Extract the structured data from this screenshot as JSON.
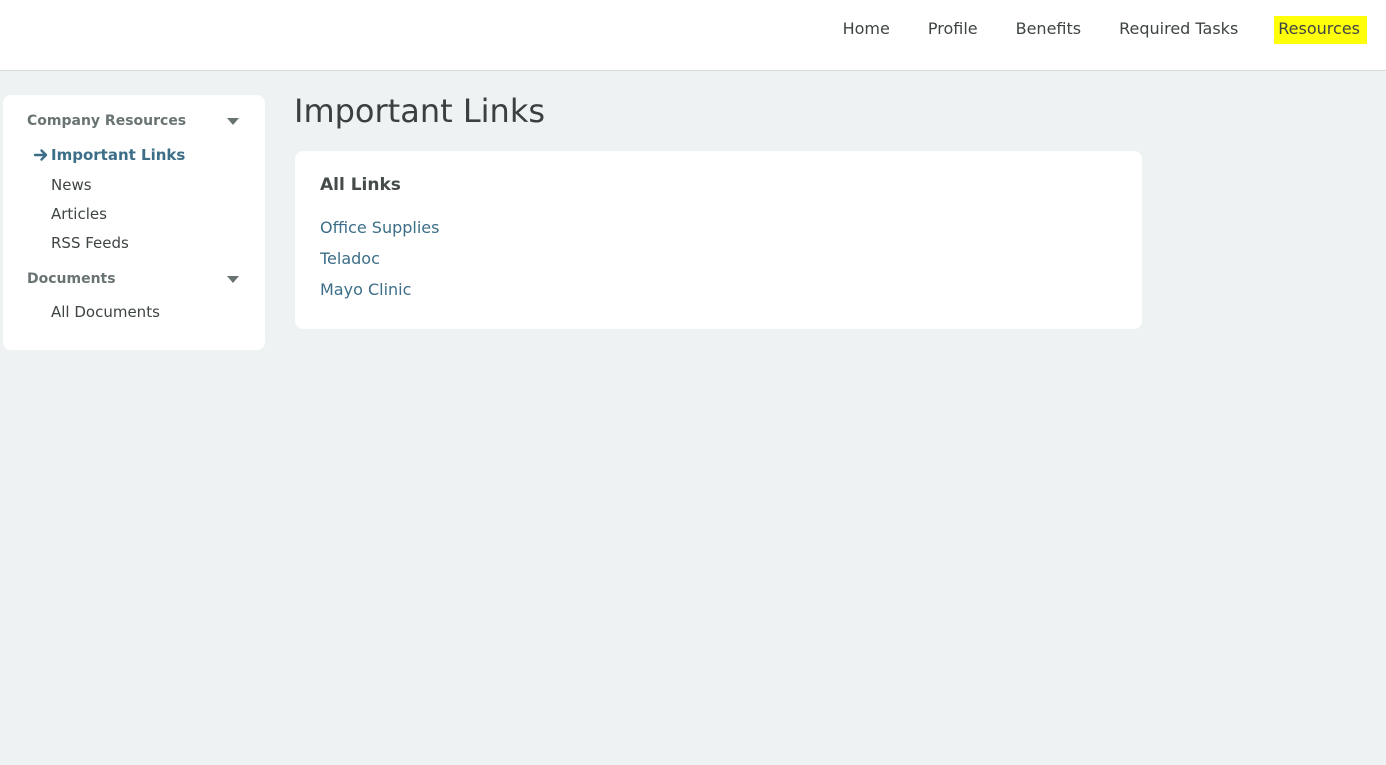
{
  "topnav": {
    "items": [
      {
        "label": "Home"
      },
      {
        "label": "Profile"
      },
      {
        "label": "Benefits"
      },
      {
        "label": "Required Tasks"
      },
      {
        "label": "Resources",
        "active": true
      }
    ],
    "highlight_color": "#ffff0a"
  },
  "sidebar": {
    "sections": [
      {
        "label": "Company Resources",
        "items": [
          {
            "label": "Important Links",
            "current": true
          },
          {
            "label": "News"
          },
          {
            "label": "Articles"
          },
          {
            "label": "RSS Feeds"
          }
        ]
      },
      {
        "label": "Documents",
        "items": [
          {
            "label": "All Documents"
          }
        ]
      }
    ],
    "current_icon": "arrow-right-icon"
  },
  "main": {
    "title": "Important Links",
    "card": {
      "heading": "All Links",
      "links": [
        {
          "label": "Office Supplies"
        },
        {
          "label": "Teladoc"
        },
        {
          "label": "Mayo Clinic"
        }
      ]
    }
  },
  "colors": {
    "accent": "#3c6e88",
    "page_background": "#eef2f2",
    "text": "#3e4444"
  }
}
